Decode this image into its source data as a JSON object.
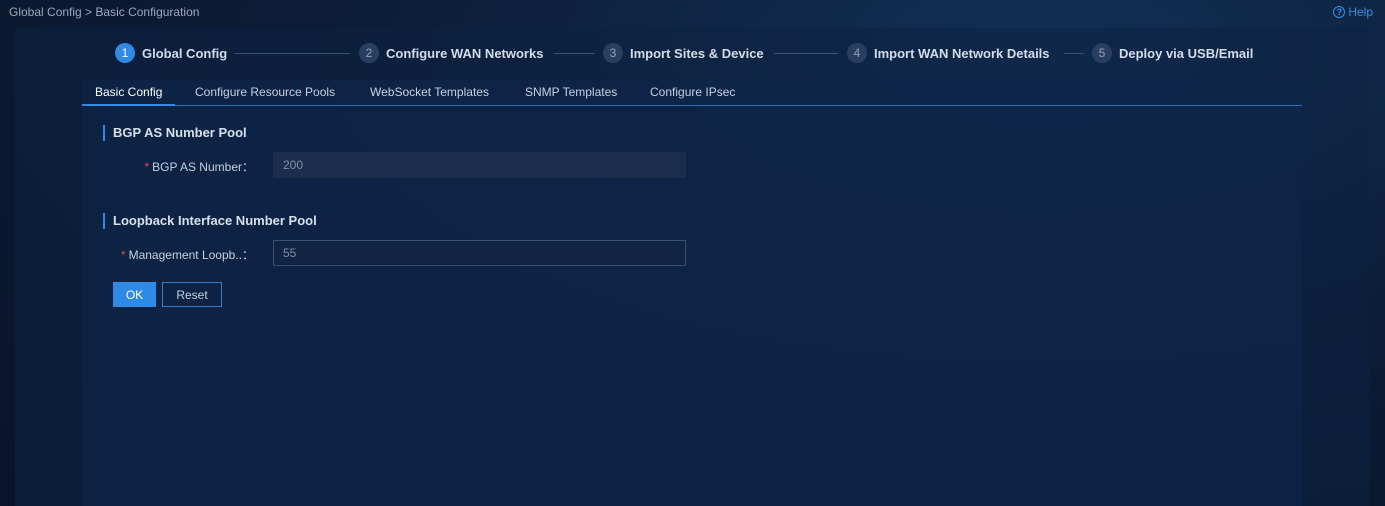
{
  "breadcrumb": "Global Config > Basic Configuration",
  "help_label": "Help",
  "steps": [
    {
      "num": "1",
      "label": "Global Config",
      "active": true
    },
    {
      "num": "2",
      "label": "Configure WAN Networks"
    },
    {
      "num": "3",
      "label": "Import Sites & Device"
    },
    {
      "num": "4",
      "label": "Import WAN Network Details"
    },
    {
      "num": "5",
      "label": "Deploy via USB/Email"
    }
  ],
  "tabs": [
    {
      "label": "Basic Config",
      "active": true
    },
    {
      "label": "Configure Resource Pools"
    },
    {
      "label": "WebSocket Templates"
    },
    {
      "label": "SNMP Templates"
    },
    {
      "label": "Configure IPsec"
    }
  ],
  "sections": {
    "bgp": {
      "title": "BGP AS Number Pool",
      "field_label": "BGP AS Number：",
      "field_value": "200"
    },
    "loopback": {
      "title": "Loopback Interface Number Pool",
      "field_label": "Management Loopb..：",
      "field_value": "55"
    }
  },
  "required_mark": "*",
  "buttons": {
    "ok": "OK",
    "reset": "Reset"
  },
  "colors": {
    "accent": "#2f8ae5",
    "required": "#e5484d",
    "link": "#3a8ee6"
  }
}
